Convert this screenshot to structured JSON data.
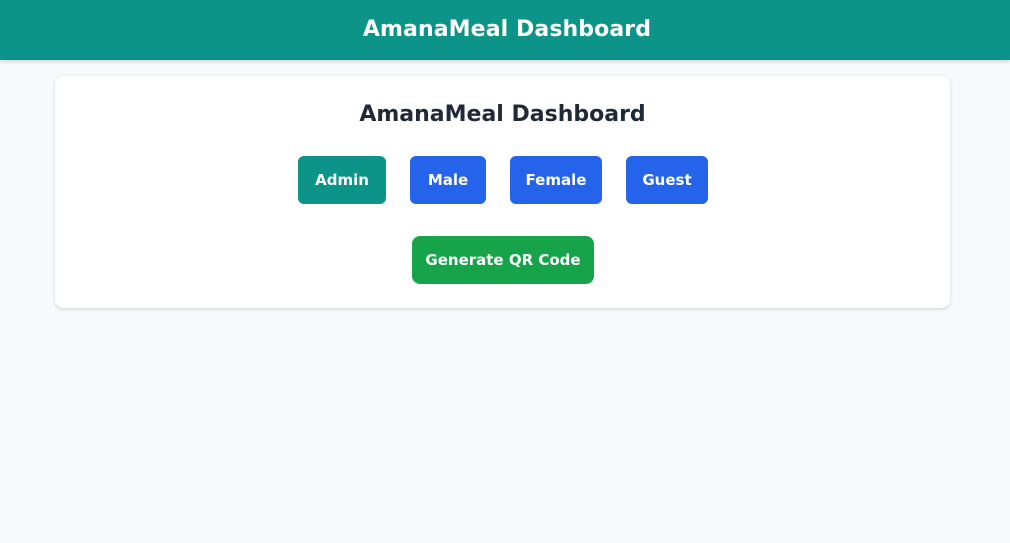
{
  "header": {
    "title": "AmanaMeal Dashboard"
  },
  "main": {
    "title": "AmanaMeal Dashboard",
    "role_buttons": [
      {
        "label": "Admin"
      },
      {
        "label": "Male"
      },
      {
        "label": "Female"
      },
      {
        "label": "Guest"
      }
    ],
    "generate_qr_label": "Generate QR Code"
  },
  "colors": {
    "header_bg": "#0c9488",
    "admin_button": "#0c9488",
    "role_button": "#2563eb",
    "qr_button": "#16a34a",
    "page_bg": "#f8f9fb"
  }
}
